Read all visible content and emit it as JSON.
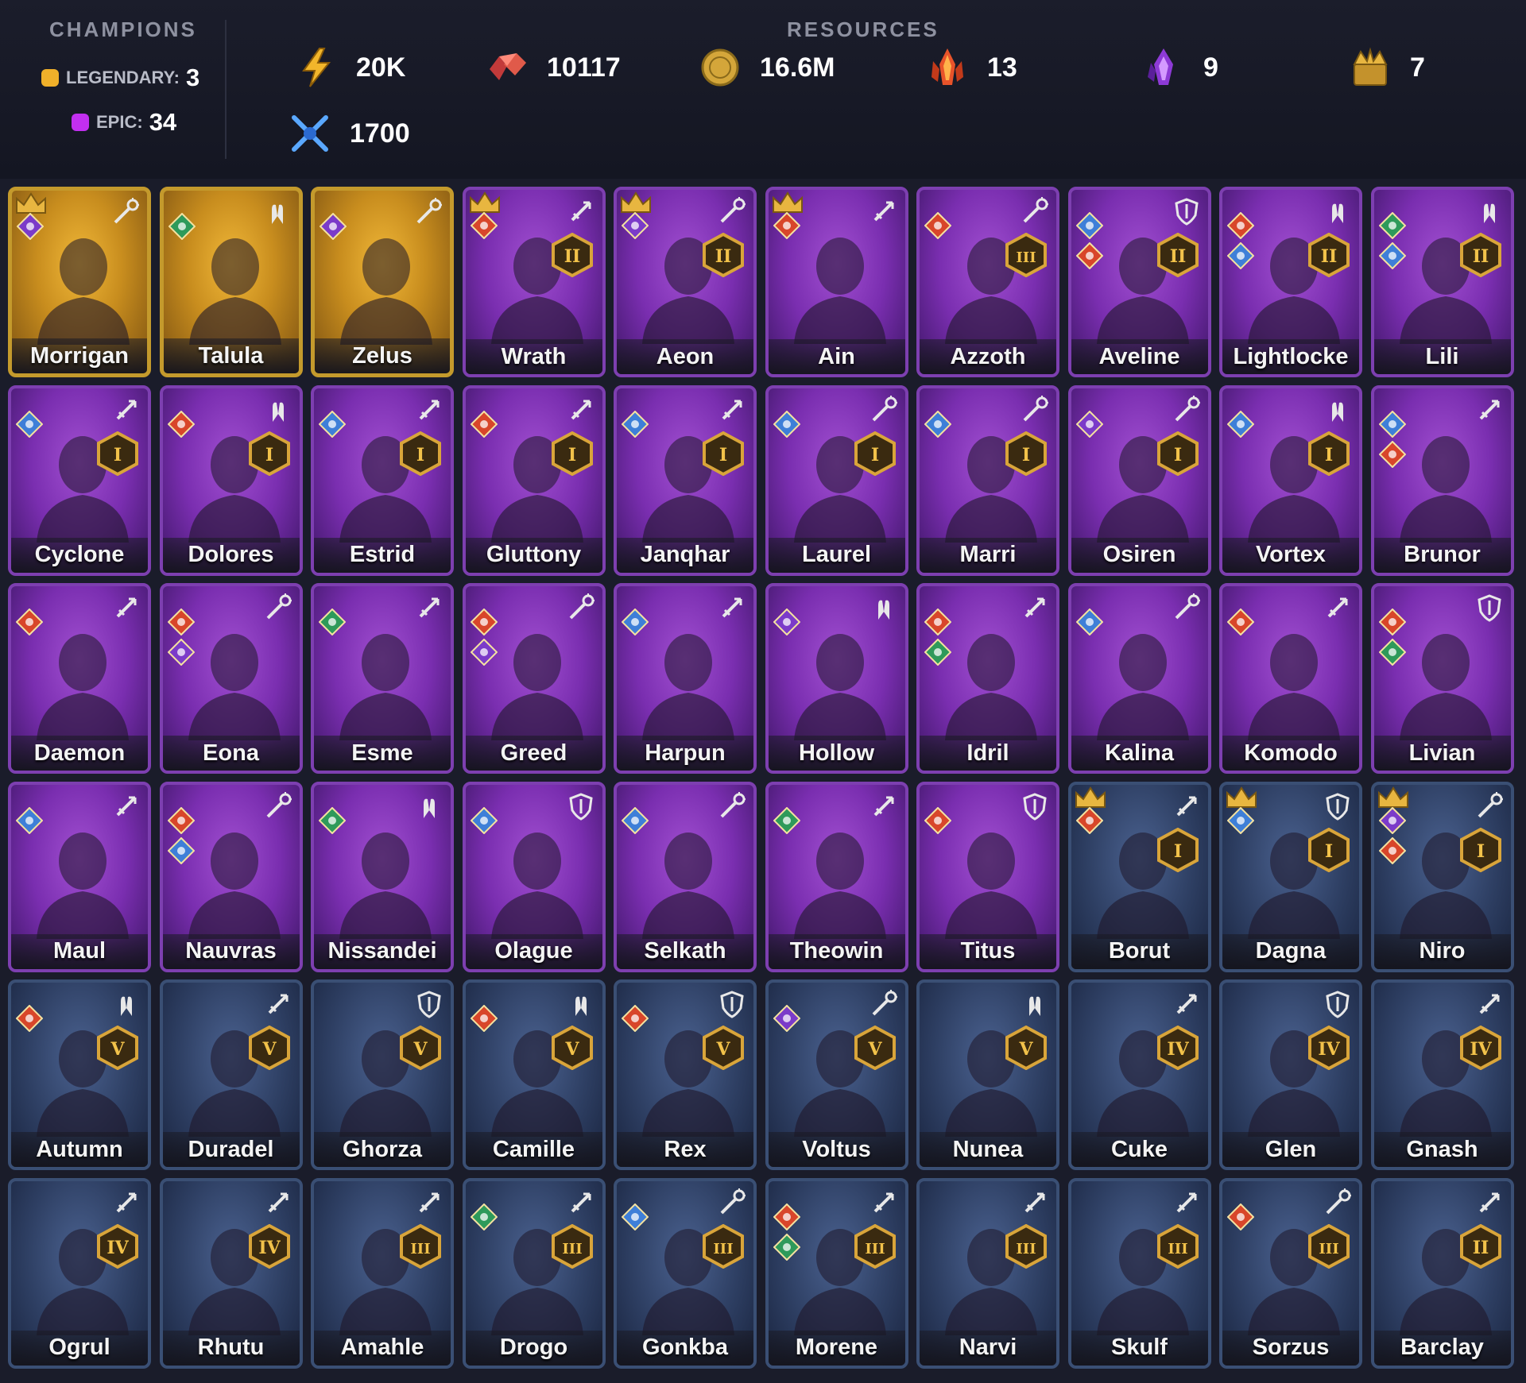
{
  "header": {
    "champions_label": "CHAMPIONS",
    "resources_label": "RESOURCES",
    "legendary": {
      "label": "LEGENDARY:",
      "count": "3",
      "color": "#f0b02a"
    },
    "epic": {
      "label": "EPIC:",
      "count": "34",
      "color": "#c22ff0"
    }
  },
  "resources": [
    {
      "icon": "energy-bolt-icon",
      "value": "20K"
    },
    {
      "icon": "gems-icon",
      "value": "10117"
    },
    {
      "icon": "silver-coin-icon",
      "value": "16.6M"
    },
    {
      "icon": "flame-shard-icon",
      "value": "13"
    },
    {
      "icon": "void-shard-icon",
      "value": "9"
    },
    {
      "icon": "gold-chest-icon",
      "value": "7"
    },
    {
      "icon": "arena-swords-icon",
      "value": "1700"
    }
  ],
  "colors": {
    "legendary": "#c49a2c",
    "epic": "#7d3fb0",
    "rare": "#3a4f74",
    "magic": "#3e7fd8",
    "force": "#d8462a",
    "spirit": "#2e9a5a",
    "void": "#7b3bc9"
  },
  "champions": [
    {
      "name": "Morrigan",
      "rarity": "legendary",
      "role": "support",
      "affinities": [
        "void"
      ],
      "crown": true,
      "tier": null
    },
    {
      "name": "Talula",
      "rarity": "legendary",
      "role": "hp",
      "affinities": [
        "spirit"
      ],
      "crown": false,
      "tier": null
    },
    {
      "name": "Zelus",
      "rarity": "legendary",
      "role": "support",
      "affinities": [
        "void"
      ],
      "crown": false,
      "tier": null
    },
    {
      "name": "Wrath",
      "rarity": "epic",
      "role": "attack",
      "affinities": [
        "force"
      ],
      "crown": true,
      "tier": "II"
    },
    {
      "name": "Aeon",
      "rarity": "epic",
      "role": "support",
      "affinities": [
        "void"
      ],
      "crown": true,
      "tier": "II"
    },
    {
      "name": "Ain",
      "rarity": "epic",
      "role": "attack",
      "affinities": [
        "force"
      ],
      "crown": true,
      "tier": null
    },
    {
      "name": "Azzoth",
      "rarity": "epic",
      "role": "support",
      "affinities": [
        "force"
      ],
      "crown": false,
      "tier": "III"
    },
    {
      "name": "Aveline",
      "rarity": "epic",
      "role": "defense",
      "affinities": [
        "magic",
        "force"
      ],
      "crown": false,
      "tier": "II"
    },
    {
      "name": "Lightlocke",
      "rarity": "epic",
      "role": "hp",
      "affinities": [
        "force",
        "magic"
      ],
      "crown": false,
      "tier": "II"
    },
    {
      "name": "Lili",
      "rarity": "epic",
      "role": "hp",
      "affinities": [
        "spirit",
        "magic"
      ],
      "crown": false,
      "tier": "II"
    },
    {
      "name": "Cyclone",
      "rarity": "epic",
      "role": "attack",
      "affinities": [
        "magic"
      ],
      "crown": false,
      "tier": "I"
    },
    {
      "name": "Dolores",
      "rarity": "epic",
      "role": "hp",
      "affinities": [
        "force"
      ],
      "crown": false,
      "tier": "I"
    },
    {
      "name": "Estrid",
      "rarity": "epic",
      "role": "attack",
      "affinities": [
        "magic"
      ],
      "crown": false,
      "tier": "I"
    },
    {
      "name": "Gluttony",
      "rarity": "epic",
      "role": "attack",
      "affinities": [
        "force"
      ],
      "crown": false,
      "tier": "I"
    },
    {
      "name": "Janqhar",
      "rarity": "epic",
      "role": "attack",
      "affinities": [
        "magic"
      ],
      "crown": false,
      "tier": "I"
    },
    {
      "name": "Laurel",
      "rarity": "epic",
      "role": "support",
      "affinities": [
        "magic"
      ],
      "crown": false,
      "tier": "I"
    },
    {
      "name": "Marri",
      "rarity": "epic",
      "role": "support",
      "affinities": [
        "magic"
      ],
      "crown": false,
      "tier": "I"
    },
    {
      "name": "Osiren",
      "rarity": "epic",
      "role": "support",
      "affinities": [
        "void"
      ],
      "crown": false,
      "tier": "I"
    },
    {
      "name": "Vortex",
      "rarity": "epic",
      "role": "hp",
      "affinities": [
        "magic"
      ],
      "crown": false,
      "tier": "I"
    },
    {
      "name": "Brunor",
      "rarity": "epic",
      "role": "attack",
      "affinities": [
        "magic",
        "force"
      ],
      "crown": false,
      "tier": null
    },
    {
      "name": "Daemon",
      "rarity": "epic",
      "role": "attack",
      "affinities": [
        "force"
      ],
      "crown": false,
      "tier": null
    },
    {
      "name": "Eona",
      "rarity": "epic",
      "role": "support",
      "affinities": [
        "force",
        "void"
      ],
      "crown": false,
      "tier": null
    },
    {
      "name": "Esme",
      "rarity": "epic",
      "role": "attack",
      "affinities": [
        "spirit"
      ],
      "crown": false,
      "tier": null
    },
    {
      "name": "Greed",
      "rarity": "epic",
      "role": "support",
      "affinities": [
        "force",
        "void"
      ],
      "crown": false,
      "tier": null
    },
    {
      "name": "Harpun",
      "rarity": "epic",
      "role": "attack",
      "affinities": [
        "magic"
      ],
      "crown": false,
      "tier": null
    },
    {
      "name": "Hollow",
      "rarity": "epic",
      "role": "hp",
      "affinities": [
        "void"
      ],
      "crown": false,
      "tier": null
    },
    {
      "name": "Idril",
      "rarity": "epic",
      "role": "attack",
      "affinities": [
        "force",
        "spirit"
      ],
      "crown": false,
      "tier": null
    },
    {
      "name": "Kalina",
      "rarity": "epic",
      "role": "support",
      "affinities": [
        "magic"
      ],
      "crown": false,
      "tier": null
    },
    {
      "name": "Komodo",
      "rarity": "epic",
      "role": "attack",
      "affinities": [
        "force"
      ],
      "crown": false,
      "tier": null
    },
    {
      "name": "Livian",
      "rarity": "epic",
      "role": "defense",
      "affinities": [
        "force",
        "spirit"
      ],
      "crown": false,
      "tier": null
    },
    {
      "name": "Maul",
      "rarity": "epic",
      "role": "attack",
      "affinities": [
        "magic"
      ],
      "crown": false,
      "tier": null
    },
    {
      "name": "Nauvras",
      "rarity": "epic",
      "role": "support",
      "affinities": [
        "force",
        "magic"
      ],
      "crown": false,
      "tier": null
    },
    {
      "name": "Nissandei",
      "rarity": "epic",
      "role": "hp",
      "affinities": [
        "spirit"
      ],
      "crown": false,
      "tier": null
    },
    {
      "name": "Olague",
      "rarity": "epic",
      "role": "defense",
      "affinities": [
        "magic"
      ],
      "crown": false,
      "tier": null
    },
    {
      "name": "Selkath",
      "rarity": "epic",
      "role": "support",
      "affinities": [
        "magic"
      ],
      "crown": false,
      "tier": null
    },
    {
      "name": "Theowin",
      "rarity": "epic",
      "role": "attack",
      "affinities": [
        "spirit"
      ],
      "crown": false,
      "tier": null
    },
    {
      "name": "Titus",
      "rarity": "epic",
      "role": "defense",
      "affinities": [
        "force"
      ],
      "crown": false,
      "tier": null
    },
    {
      "name": "Borut",
      "rarity": "rare",
      "role": "attack",
      "affinities": [
        "force"
      ],
      "crown": true,
      "tier": "I"
    },
    {
      "name": "Dagna",
      "rarity": "rare",
      "role": "defense",
      "affinities": [
        "magic"
      ],
      "crown": true,
      "tier": "I"
    },
    {
      "name": "Niro",
      "rarity": "rare",
      "role": "support",
      "affinities": [
        "void",
        "force"
      ],
      "crown": true,
      "tier": "I"
    },
    {
      "name": "Autumn",
      "rarity": "rare",
      "role": "hp",
      "affinities": [
        "force"
      ],
      "crown": false,
      "tier": "V"
    },
    {
      "name": "Duradel",
      "rarity": "rare",
      "role": "attack",
      "affinities": [],
      "crown": false,
      "tier": "V"
    },
    {
      "name": "Ghorza",
      "rarity": "rare",
      "role": "defense",
      "affinities": [],
      "crown": false,
      "tier": "V"
    },
    {
      "name": "Camille",
      "rarity": "rare",
      "role": "hp",
      "affinities": [
        "force"
      ],
      "crown": false,
      "tier": "V"
    },
    {
      "name": "Rex",
      "rarity": "rare",
      "role": "defense",
      "affinities": [
        "force"
      ],
      "crown": false,
      "tier": "V"
    },
    {
      "name": "Voltus",
      "rarity": "rare",
      "role": "support",
      "affinities": [
        "void"
      ],
      "crown": false,
      "tier": "V"
    },
    {
      "name": "Nunea",
      "rarity": "rare",
      "role": "hp",
      "affinities": [],
      "crown": false,
      "tier": "V"
    },
    {
      "name": "Cuke",
      "rarity": "rare",
      "role": "attack",
      "affinities": [],
      "crown": false,
      "tier": "IV"
    },
    {
      "name": "Glen",
      "rarity": "rare",
      "role": "defense",
      "affinities": [],
      "crown": false,
      "tier": "IV"
    },
    {
      "name": "Gnash",
      "rarity": "rare",
      "role": "attack",
      "affinities": [],
      "crown": false,
      "tier": "IV"
    },
    {
      "name": "Ogrul",
      "rarity": "rare",
      "role": "attack",
      "affinities": [],
      "crown": false,
      "tier": "IV"
    },
    {
      "name": "Rhutu",
      "rarity": "rare",
      "role": "attack",
      "affinities": [],
      "crown": false,
      "tier": "IV"
    },
    {
      "name": "Amahle",
      "rarity": "rare",
      "role": "attack",
      "affinities": [],
      "crown": false,
      "tier": "III"
    },
    {
      "name": "Drogo",
      "rarity": "rare",
      "role": "attack",
      "affinities": [
        "spirit"
      ],
      "crown": false,
      "tier": "III"
    },
    {
      "name": "Gonkba",
      "rarity": "rare",
      "role": "support",
      "affinities": [
        "magic"
      ],
      "crown": false,
      "tier": "III"
    },
    {
      "name": "Morene",
      "rarity": "rare",
      "role": "attack",
      "affinities": [
        "force",
        "spirit"
      ],
      "crown": false,
      "tier": "III"
    },
    {
      "name": "Narvi",
      "rarity": "rare",
      "role": "attack",
      "affinities": [],
      "crown": false,
      "tier": "III"
    },
    {
      "name": "Skulf",
      "rarity": "rare",
      "role": "attack",
      "affinities": [],
      "crown": false,
      "tier": "III"
    },
    {
      "name": "Sorzus",
      "rarity": "rare",
      "role": "support",
      "affinities": [
        "force"
      ],
      "crown": false,
      "tier": "III"
    },
    {
      "name": "Barclay",
      "rarity": "rare",
      "role": "attack",
      "affinities": [],
      "crown": false,
      "tier": "II"
    }
  ]
}
